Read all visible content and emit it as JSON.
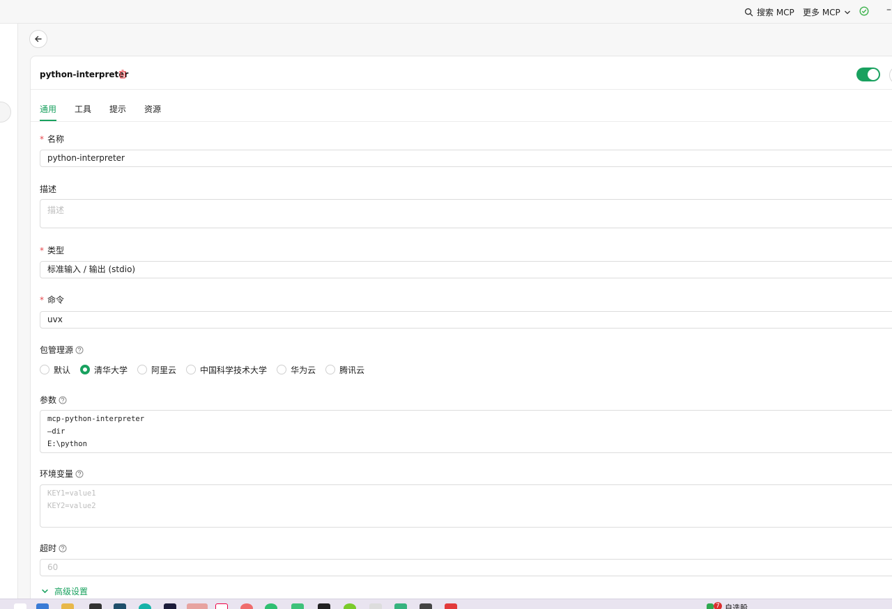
{
  "topbar": {
    "search_label": "搜索 MCP",
    "more_label": "更多 MCP",
    "minimize_glyph": "–"
  },
  "server": {
    "name": "python-interpreter",
    "enabled": true
  },
  "tabs": [
    {
      "label": "通用",
      "active": true
    },
    {
      "label": "工具",
      "active": false
    },
    {
      "label": "提示",
      "active": false
    },
    {
      "label": "资源",
      "active": false
    }
  ],
  "form": {
    "name": {
      "label": "名称",
      "required": true,
      "value": "python-interpreter"
    },
    "description": {
      "label": "描述",
      "required": false,
      "placeholder": "描述"
    },
    "type": {
      "label": "类型",
      "required": true,
      "value": "标准输入 / 输出 (stdio)"
    },
    "command": {
      "label": "命令",
      "required": true,
      "value": "uvx"
    },
    "registry": {
      "label": "包管理源",
      "options": [
        "默认",
        "清华大学",
        "阿里云",
        "中国科学技术大学",
        "华为云",
        "腾讯云"
      ],
      "selected": "清华大学"
    },
    "args": {
      "label": "参数",
      "lines": [
        "mcp-python-interpreter",
        "—dir",
        "E:\\python"
      ]
    },
    "env": {
      "label": "环境变量",
      "placeholder_lines": [
        "KEY1=value1",
        "KEY2=value2"
      ]
    },
    "timeout": {
      "label": "超时",
      "placeholder": "60"
    },
    "advanced_label": "高级设置"
  },
  "taskbar": {
    "badge_count": "7",
    "stock_label": "自选股"
  },
  "colors": {
    "accent": "#19a15f",
    "required": "#e5484d",
    "danger": "#e5484d"
  }
}
